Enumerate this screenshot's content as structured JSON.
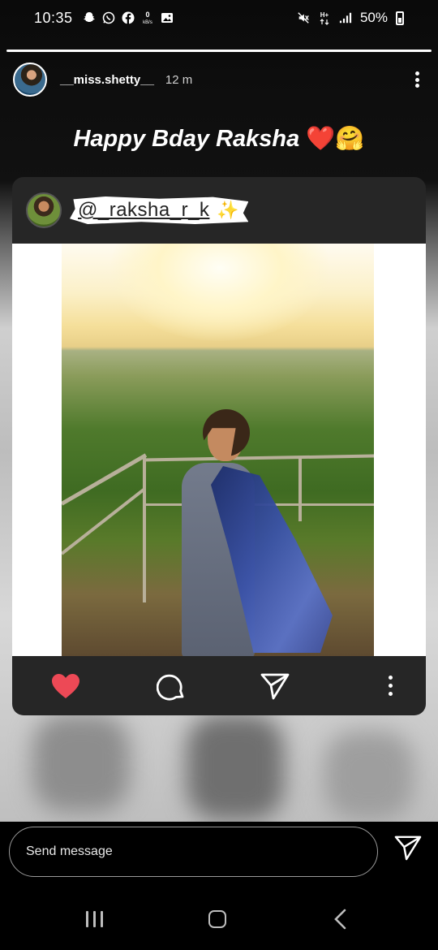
{
  "status_bar": {
    "time": "10:35",
    "left_icons": [
      "snapchat-icon",
      "whatsapp-icon",
      "facebook-icon",
      "data-speed-icon",
      "gallery-icon"
    ],
    "speed_label": "0\nkB/s",
    "right_icons": [
      "mute-icon",
      "hplus-icon",
      "signal-icon"
    ],
    "battery": "50%"
  },
  "story": {
    "progress": 1.0,
    "username": "__miss.shetty__",
    "time_ago": "12 m",
    "caption": "Happy Bday Raksha",
    "caption_emojis": "❤️🤗"
  },
  "post": {
    "mention": "@_raksha_r_k",
    "sparkle": "✨"
  },
  "reply": {
    "placeholder": "Send message"
  },
  "colors": {
    "like_red": "#ed4956",
    "card_bg": "#262626"
  }
}
